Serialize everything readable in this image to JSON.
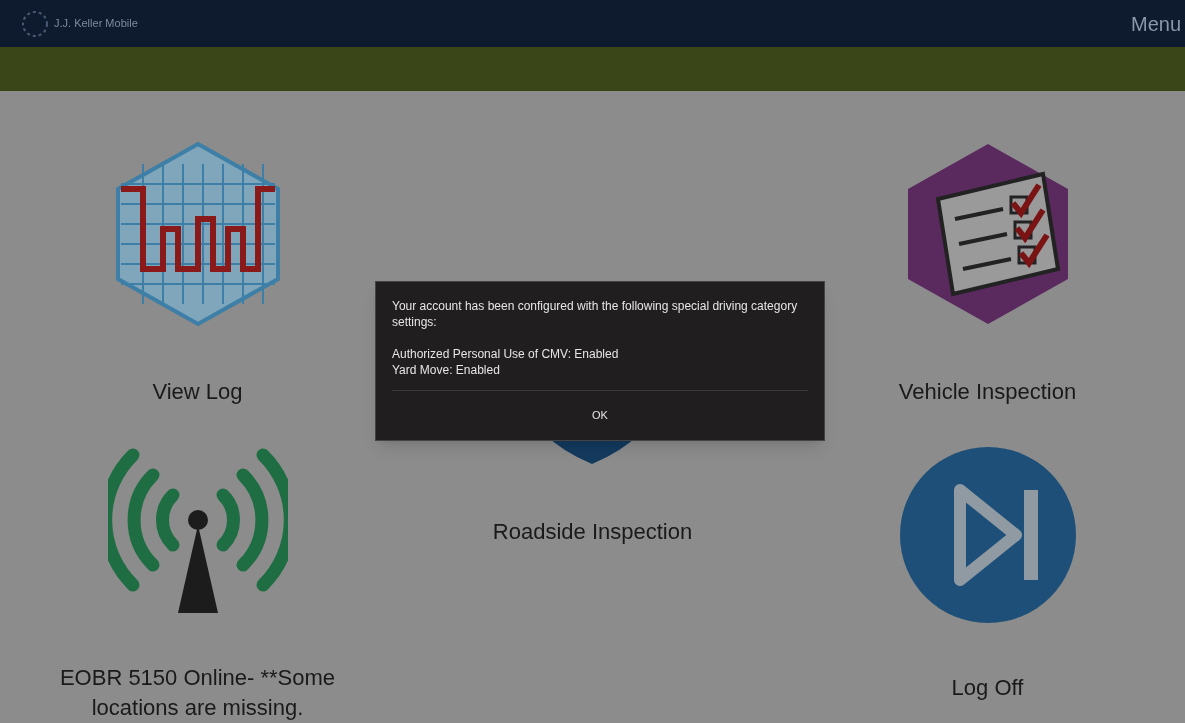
{
  "header": {
    "title": "J.J. Keller Mobile",
    "menu": "Menu"
  },
  "tiles": [
    {
      "kind": "log",
      "label": "View Log"
    },
    {
      "kind": "antenna",
      "label": "EOBR 5150 Online- **Some locations are missing."
    },
    {
      "kind": "shield",
      "label": "Roadside Inspection"
    },
    {
      "kind": "checklist",
      "label": "Vehicle Inspection"
    },
    {
      "kind": "logoff",
      "label": "Log Off"
    }
  ],
  "dialog": {
    "message": "Your account has been configured with the following special driving category settings:",
    "settings": [
      "Authorized Personal Use of CMV: Enabled",
      "Yard Move: Enabled"
    ],
    "button": "OK"
  }
}
